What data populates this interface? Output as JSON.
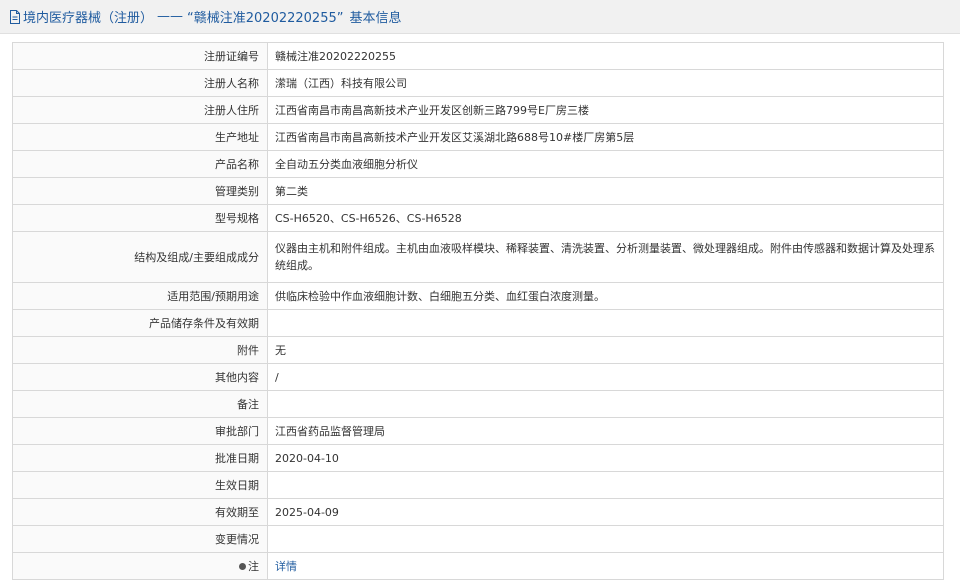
{
  "title": {
    "section": "境内医疗器械（注册）",
    "dash": "——",
    "record": "“赣械注准20202220255”",
    "suffix": "基本信息"
  },
  "rows": [
    {
      "key": "注册证编号",
      "value": "赣械注准20202220255"
    },
    {
      "key": "注册人名称",
      "value": "潆瑞（江西）科技有限公司"
    },
    {
      "key": "注册人住所",
      "value": "江西省南昌市南昌高新技术产业开发区创新三路799号E厂房三楼"
    },
    {
      "key": "生产地址",
      "value": "江西省南昌市南昌高新技术产业开发区艾溪湖北路688号10#楼厂房第5层"
    },
    {
      "key": "产品名称",
      "value": "全自动五分类血液细胞分析仪"
    },
    {
      "key": "管理类别",
      "value": "第二类"
    },
    {
      "key": "型号规格",
      "value": "CS-H6520、CS-H6526、CS-H6528"
    },
    {
      "key": "结构及组成/主要组成成分",
      "value": "仪器由主机和附件组成。主机由血液吸样模块、稀释装置、清洗装置、分析测量装置、微处理器组成。附件由传感器和数据计算及处理系统组成。"
    },
    {
      "key": "适用范围/预期用途",
      "value": "供临床检验中作血液细胞计数、白细胞五分类、血红蛋白浓度测量。"
    },
    {
      "key": "产品储存条件及有效期",
      "value": ""
    },
    {
      "key": "附件",
      "value": "无"
    },
    {
      "key": "其他内容",
      "value": "/"
    },
    {
      "key": "备注",
      "value": ""
    },
    {
      "key": "审批部门",
      "value": "江西省药品监督管理局"
    },
    {
      "key": "批准日期",
      "value": "2020-04-10"
    },
    {
      "key": "生效日期",
      "value": ""
    },
    {
      "key": "有效期至",
      "value": "2025-04-09"
    },
    {
      "key": "变更情况",
      "value": ""
    }
  ],
  "note": {
    "key": "注",
    "link": "详情"
  }
}
